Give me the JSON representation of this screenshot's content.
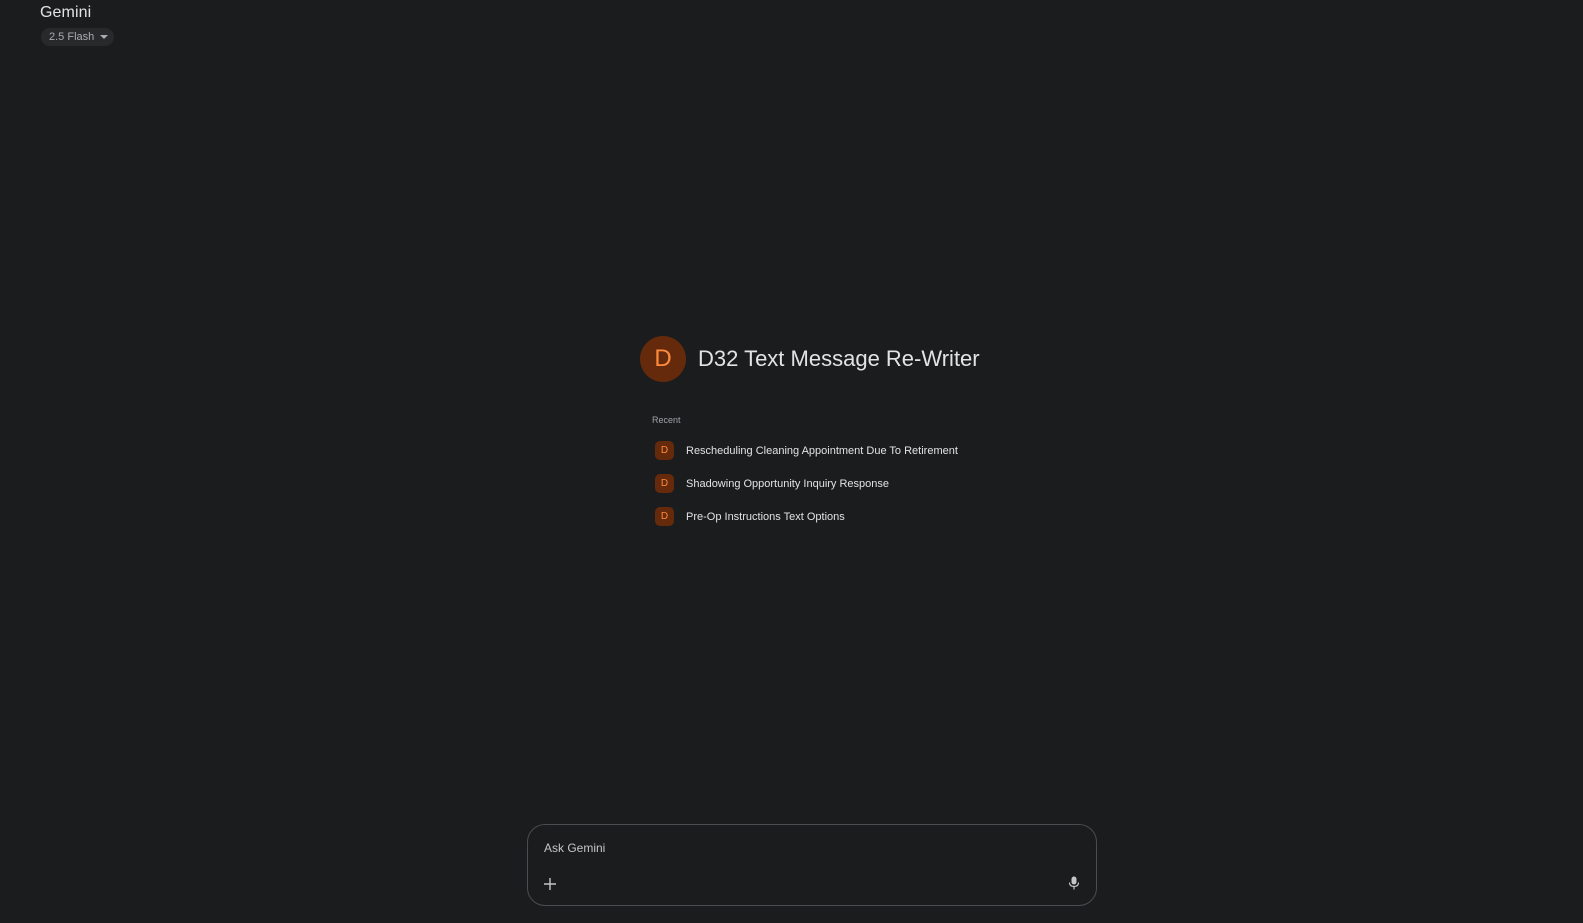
{
  "header": {
    "app_title": "Gemini",
    "model_label": "2.5 Flash"
  },
  "gem": {
    "initial": "D",
    "name": "D32 Text Message Re-Writer"
  },
  "recent": {
    "label": "Recent",
    "items": [
      {
        "initial": "D",
        "title": "Rescheduling Cleaning Appointment Due To Retirement"
      },
      {
        "initial": "D",
        "title": "Shadowing Opportunity Inquiry Response"
      },
      {
        "initial": "D",
        "title": "Pre-Op Instructions Text Options"
      }
    ]
  },
  "prompt": {
    "placeholder": "Ask Gemini",
    "value": "",
    "add_icon": "plus-icon",
    "mic_icon": "microphone-icon"
  },
  "colors": {
    "background": "#1b1c1d",
    "gem_avatar_bg": "#652a0b",
    "gem_avatar_fg": "#ff8a3d"
  }
}
